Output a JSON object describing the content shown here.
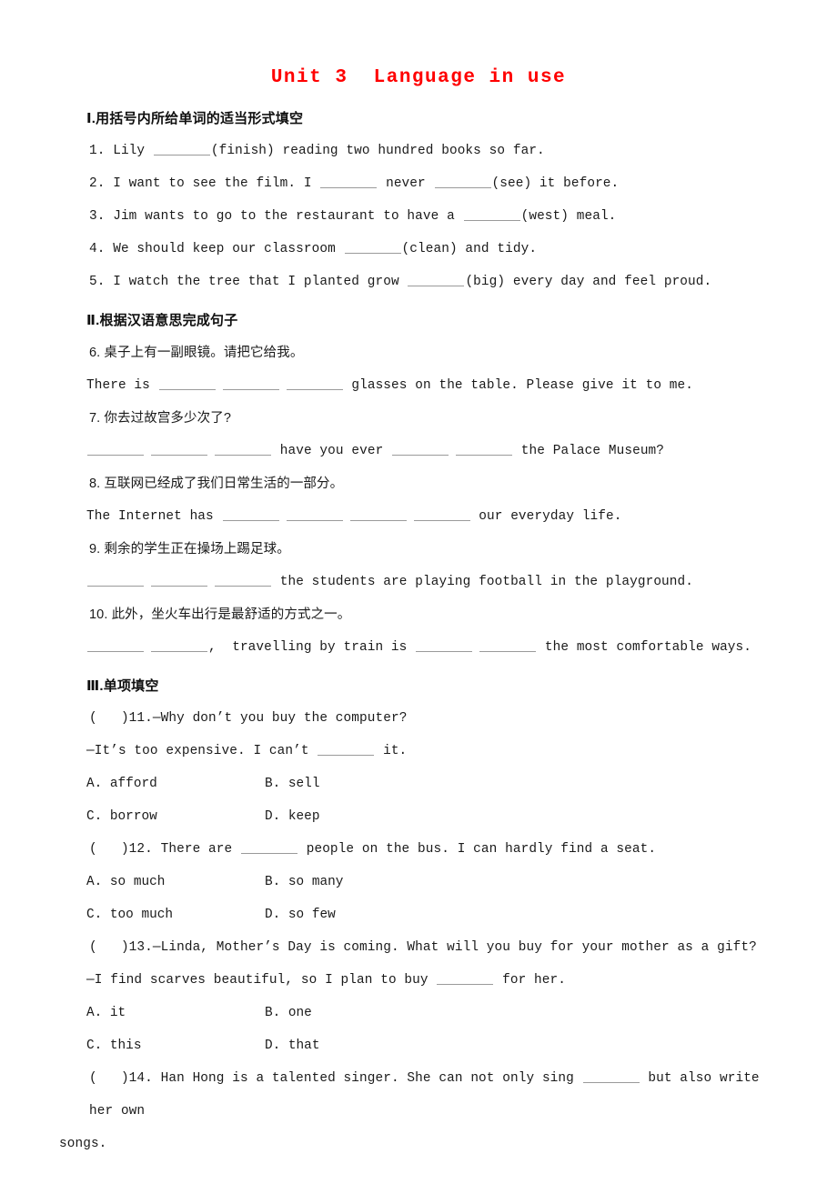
{
  "document": {
    "title": "Unit 3  Language in use",
    "title_color": "#ff0000",
    "background_color": "#ffffff"
  },
  "sections": [
    {
      "id": "section-1",
      "heading": "Ⅰ.用括号内所给单词的适当形式填空",
      "items": [
        {
          "number": "1.",
          "parts": [
            "1. Lily ",
            "BLANK",
            "(finish) reading two hundred books so far."
          ]
        },
        {
          "number": "2.",
          "parts": [
            "2. I want to see the film. I ",
            "BLANK",
            " never ",
            "BLANK",
            "(see) it before."
          ]
        },
        {
          "number": "3.",
          "parts": [
            "3. Jim wants to go to the restaurant to have a ",
            "BLANK",
            "(west) meal."
          ]
        },
        {
          "number": "4.",
          "parts": [
            "4. We should keep our classroom ",
            "BLANK",
            "(clean) and tidy."
          ]
        },
        {
          "number": "5.",
          "parts": [
            "5. I watch the tree that I planted grow ",
            "BLANK",
            "(big) every day and feel proud."
          ]
        }
      ],
      "lines": {
        "q1_pre": "1. Lily ",
        "q1_post": "(finish) reading two hundred books so far.",
        "q2_pre": "2. I want to see the film. I ",
        "q2_mid": " never ",
        "q2_post": "(see) it before.",
        "q3_pre": "3. Jim wants to go to the restaurant to have a ",
        "q3_post": "(west) meal.",
        "q4_pre": "4. We should keep our classroom ",
        "q4_post": "(clean) and tidy.",
        "q5_pre": "5. I watch the tree that I planted grow ",
        "q5_post": "(big) every day and feel proud."
      }
    },
    {
      "id": "section-2",
      "heading": "Ⅱ.根据汉语意思完成句子",
      "lines": {
        "q6_cn": "6. 桌子上有一副眼镜。请把它给我。",
        "q6_pre": "There is ",
        "q6_post": " glasses on the table. Please give it to me.",
        "q7_cn": "7. 你去过故宫多少次了?",
        "q7_mid": " have you ever ",
        "q7_post": " the Palace Museum?",
        "q8_cn": "8. 互联网已经成了我们日常生活的一部分。",
        "q8_pre": "The Internet has ",
        "q8_post": " our everyday life.",
        "q9_cn": "9. 剩余的学生正在操场上踢足球。",
        "q9_post": " the students are playing football in the playground.",
        "q10_cn": "10. 此外，坐火车出行是最舒适的方式之一。",
        "q10_comma": ",  travelling by train is ",
        "q10_post": " the most comfortable ways."
      }
    },
    {
      "id": "section-3",
      "heading": "Ⅲ.单项填空",
      "questions": [
        {
          "bracket": "(   )",
          "number": "11.",
          "stem": "(   )11.—Why don’t you buy the computer?",
          "answer_pre": "—It’s too expensive. I can’t ",
          "answer_post": " it.",
          "options": [
            {
              "key": "A.",
              "label": "A. afford"
            },
            {
              "key": "B.",
              "label": "B. sell"
            },
            {
              "key": "C.",
              "label": "C. borrow"
            },
            {
              "key": "D.",
              "label": "D. keep"
            }
          ]
        },
        {
          "bracket": "(   )",
          "number": "12.",
          "stem_pre": "(   )12. There are ",
          "stem_post": " people on the bus. I can hardly find a seat.",
          "options": [
            {
              "key": "A.",
              "label": "A. so much"
            },
            {
              "key": "B.",
              "label": "B. so many"
            },
            {
              "key": "C.",
              "label": "C. too much"
            },
            {
              "key": "D.",
              "label": "D. so few"
            }
          ]
        },
        {
          "bracket": "(   )",
          "number": "13.",
          "stem": "(   )13.—Linda, Mother’s Day is coming. What will you buy for your mother as a gift?",
          "answer_pre": "—I find scarves beautiful, so I plan to buy ",
          "answer_post": " for her.",
          "options": [
            {
              "key": "A.",
              "label": "A. it"
            },
            {
              "key": "B.",
              "label": "B. one"
            },
            {
              "key": "C.",
              "label": "C. this"
            },
            {
              "key": "D.",
              "label": "D. that"
            }
          ]
        },
        {
          "bracket": "(   )",
          "number": "14.",
          "stem_pre": "(   )14. Han Hong is a talented singer. She can not only sing ",
          "stem_post": " but also write her own",
          "stem_wrap": "songs."
        }
      ]
    }
  ]
}
